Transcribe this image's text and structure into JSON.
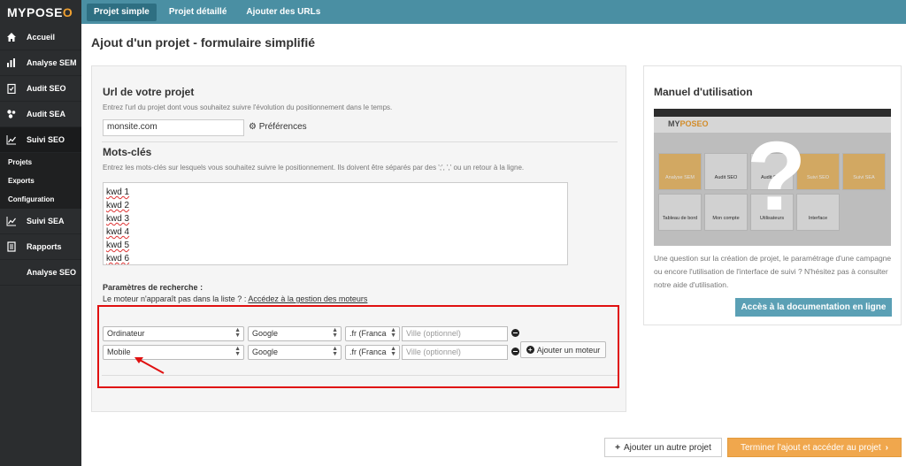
{
  "logo": {
    "part1": "MY",
    "part2": "POSE",
    "part3": "O"
  },
  "sidebar": {
    "items": [
      {
        "label": "Accueil",
        "icon": "home-icon"
      },
      {
        "label": "Analyse SEM",
        "icon": "bar-chart-icon"
      },
      {
        "label": "Audit SEO",
        "icon": "clipboard-check-icon"
      },
      {
        "label": "Audit SEA",
        "icon": "cluster-icon"
      },
      {
        "label": "Suivi SEO",
        "icon": "line-chart-icon"
      },
      {
        "label": "Suivi SEA",
        "icon": "line-chart-icon"
      },
      {
        "label": "Rapports",
        "icon": "report-icon"
      },
      {
        "label": "Analyse SEO",
        "icon": ""
      }
    ],
    "subitems": [
      "Projets",
      "Exports",
      "Configuration"
    ]
  },
  "tabs": [
    "Projet simple",
    "Projet détaillé",
    "Ajouter des URLs"
  ],
  "page_title": "Ajout d'un projet - formulaire simplifié",
  "form": {
    "url_title": "Url de votre projet",
    "url_help": "Entrez l'url du projet dont vous souhaitez suivre l'évolution du positionnement dans le temps.",
    "url_value": "monsite.com",
    "preferences": "Préférences",
    "keywords_title": "Mots-clés",
    "keywords_help": "Entrez les mots-clés sur lesquels vous souhaitez suivre le positionnement. Ils doivent être séparés par des ';', ',' ou un retour à la ligne.",
    "keywords": [
      "kwd 1",
      "kwd 2",
      "kwd 3",
      "kwd 4",
      "kwd 5",
      "kwd 6"
    ],
    "params_label": "Paramètres de recherche :",
    "params_note": "Le moteur n'apparaît pas dans la liste ? : ",
    "params_link": "Accédez à la gestion des moteurs",
    "engines": [
      {
        "device": "Ordinateur",
        "engine": "Google",
        "domain": ".fr (Franca",
        "city_placeholder": "Ville (optionnel)"
      },
      {
        "device": "Mobile",
        "engine": "Google",
        "domain": ".fr (Franca",
        "city_placeholder": "Ville (optionnel)"
      }
    ],
    "add_engine": "Ajouter un moteur"
  },
  "manual": {
    "title": "Manuel d'utilisation",
    "text": "Une question sur la création de projet, le paramétrage d'une campagne ou encore l'utilisation de l'interface de suivi ? N'hésitez pas à consulter notre aide d'utilisation.",
    "button": "Accès à la documentation en ligne",
    "thumb": {
      "logo1": "MY",
      "logo2": "POSEO",
      "cards": [
        "Analyse SEM",
        "Audit SEO",
        "Audit SEA",
        "Suivi SEO",
        "Suivi SEA",
        "Tableau de bord",
        "Mon compte",
        "Utilisateurs",
        "Interface"
      ]
    }
  },
  "buttons": {
    "other": "Ajouter un autre projet",
    "finish": "Terminer l'ajout et accéder au projet"
  },
  "colors": {
    "accent": "#f0a030",
    "topbar": "#4a8fa3",
    "sidebar": "#2b2d2f",
    "highlight": "#e01010"
  }
}
